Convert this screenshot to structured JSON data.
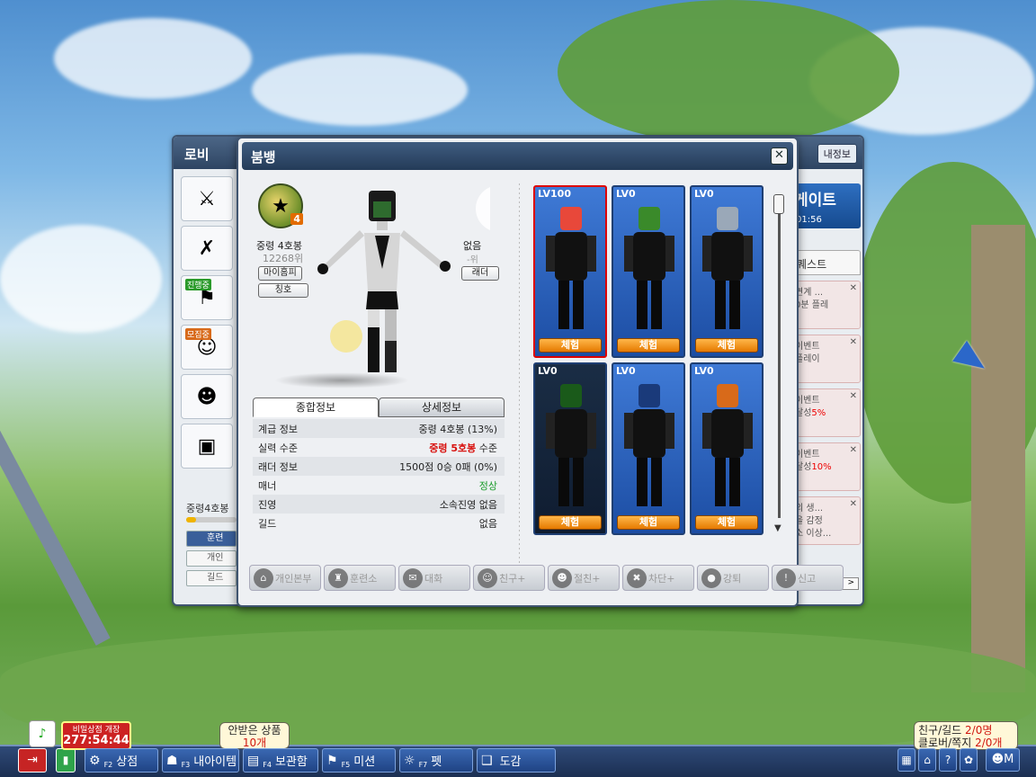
{
  "lobby": {
    "title": "로비",
    "my_info_button": "내정보",
    "grade_label": "중령4호봉",
    "tabs": [
      "훈련",
      "개인",
      "길드"
    ],
    "left_tags": [
      "진행중",
      "모집중"
    ],
    "event_banner": {
      "title": "게이트",
      "time": "01:56"
    },
    "quest_tab": "퀘스트",
    "quests": [
      {
        "line1": "연계 ...",
        "line2": "0분 플레"
      },
      {
        "line1": "이벤트",
        "line2": "플레이"
      },
      {
        "line1": "이벤트",
        "line2": "달성",
        "highlight": "5%"
      },
      {
        "line1": "이벤트",
        "line2": "달성",
        "highlight": "10%"
      },
      {
        "line1": "의 생...",
        "line2": "을 감정",
        "line3": "소 이상..."
      }
    ],
    "next_arrow": ">"
  },
  "profile": {
    "title": "붐뱅",
    "close_label": "✕",
    "grade_name": "중령 4호봉",
    "grade_exp": "12268위",
    "grade_level": "4",
    "myhome_button": "마이홈피",
    "title_button": "칭호",
    "none_label": "없음",
    "rank_suffix": "-위",
    "ladder_button": "래더",
    "tabs": [
      {
        "label": "종합정보",
        "active": true
      },
      {
        "label": "상세정보",
        "active": false
      }
    ],
    "info_rows": [
      {
        "label": "계급 정보",
        "value": "중령 4호봉 (13%)"
      },
      {
        "label": "실력 수준",
        "value_red": "중령 5호봉",
        "value_suffix": " 수준"
      },
      {
        "label": "래더 정보",
        "value": "1500점 0승 0패 (0%)"
      },
      {
        "label": "매너",
        "value_green": "정상"
      },
      {
        "label": "진영",
        "value": "소속진영 없음"
      },
      {
        "label": "길드",
        "value": "없음"
      }
    ],
    "characters": [
      {
        "level": "LV100",
        "button": "체험",
        "color": "#e8483a"
      },
      {
        "level": "LV0",
        "button": "체험",
        "color": "#3a8a2a"
      },
      {
        "level": "LV0",
        "button": "체험",
        "color": "#9aa8b8"
      },
      {
        "level": "LV0",
        "button": "체험",
        "color": "#1a5a1a"
      },
      {
        "level": "LV0",
        "button": "체험",
        "color": "#1a3a7a"
      },
      {
        "level": "LV0",
        "button": "체험",
        "color": "#d86a1a"
      }
    ],
    "actions": [
      {
        "label": "개인본부",
        "icon": "house-icon",
        "glyph": "⌂"
      },
      {
        "label": "훈련소",
        "icon": "training-icon",
        "glyph": "♜"
      },
      {
        "label": "대화",
        "icon": "chat-icon",
        "glyph": "✉"
      },
      {
        "label": "친구+",
        "icon": "friend-icon",
        "glyph": "☺"
      },
      {
        "label": "절친+",
        "icon": "best-friend-icon",
        "glyph": "☻"
      },
      {
        "label": "차단+",
        "icon": "block-icon",
        "glyph": "✖"
      },
      {
        "label": "강퇴",
        "icon": "bomb-icon",
        "glyph": "●"
      },
      {
        "label": "신고",
        "icon": "report-icon",
        "glyph": "!"
      }
    ]
  },
  "hud": {
    "exit_glyph": "⇥",
    "battery_glyph": "▮",
    "green_tip_glyph": "♪",
    "secret_shop": {
      "title": "비밀상점 개장",
      "timer": "277:54:44"
    },
    "unreceived": {
      "label": "안받은 상품",
      "count": "10개"
    },
    "buttons": [
      {
        "key": "F2",
        "label": "상점",
        "icon": "shop-icon",
        "glyph": "⚙"
      },
      {
        "key": "F3",
        "label": "내아이템",
        "icon": "item-icon",
        "glyph": "☗"
      },
      {
        "key": "F4",
        "label": "보관함",
        "icon": "storage-icon",
        "glyph": "▤"
      },
      {
        "key": "F5",
        "label": "미션",
        "icon": "mission-icon",
        "glyph": "⚑"
      },
      {
        "key": "F7",
        "label": "펫",
        "icon": "pet-icon",
        "glyph": "☼"
      },
      {
        "key": "",
        "label": "도감",
        "icon": "book-icon",
        "glyph": "❑"
      }
    ],
    "friend_info": {
      "friend_label": "친구/길드",
      "friend_value": "2/0명",
      "clover_label": "클로버/쪽지",
      "clover_value": "2/0개"
    },
    "right_icons": [
      {
        "icon": "building-icon",
        "glyph": "▦"
      },
      {
        "icon": "home-icon",
        "glyph": "⌂"
      },
      {
        "icon": "help-icon",
        "glyph": "?"
      },
      {
        "icon": "settings-icon",
        "glyph": "✿"
      }
    ],
    "friends_icon_glyph": "☻M"
  }
}
